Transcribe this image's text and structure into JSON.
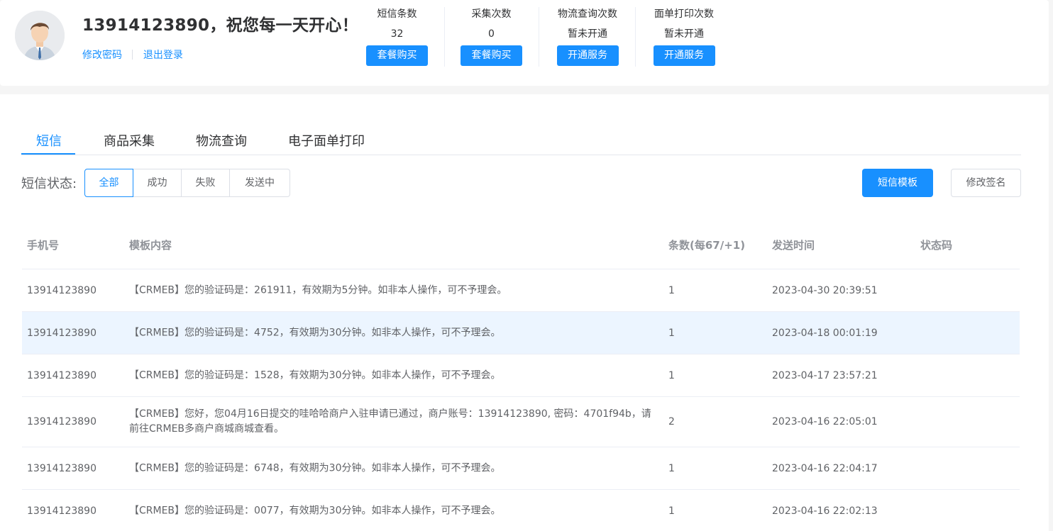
{
  "header": {
    "greeting": "13914123890，祝您每一天开心！",
    "links": {
      "change_password": "修改密码",
      "logout": "退出登录"
    },
    "stats": [
      {
        "label": "短信条数",
        "value": "32",
        "button": "套餐购买"
      },
      {
        "label": "采集次数",
        "value": "0",
        "button": "套餐购买"
      },
      {
        "label": "物流查询次数",
        "value": "暂未开通",
        "button": "开通服务"
      },
      {
        "label": "面单打印次数",
        "value": "暂未开通",
        "button": "开通服务"
      }
    ]
  },
  "tabs": [
    "短信",
    "商品采集",
    "物流查询",
    "电子面单打印"
  ],
  "active_tab": "短信",
  "filter": {
    "label": "短信状态:",
    "options": [
      "全部",
      "成功",
      "失败",
      "发送中"
    ],
    "selected": "全部"
  },
  "actions": {
    "template": "短信模板",
    "signature": "修改签名"
  },
  "table": {
    "columns": [
      "手机号",
      "模板内容",
      "条数(每67/+1)",
      "发送时间",
      "状态码"
    ],
    "rows": [
      {
        "phone": "13914123890",
        "content": "【CRMEB】您的验证码是：261911，有效期为5分钟。如非本人操作，可不予理会。",
        "count": "1",
        "time": "2023-04-30 20:39:51",
        "status": ""
      },
      {
        "phone": "13914123890",
        "content": "【CRMEB】您的验证码是：4752，有效期为30分钟。如非本人操作，可不予理会。",
        "count": "1",
        "time": "2023-04-18 00:01:19",
        "status": ""
      },
      {
        "phone": "13914123890",
        "content": "【CRMEB】您的验证码是：1528，有效期为30分钟。如非本人操作，可不予理会。",
        "count": "1",
        "time": "2023-04-17 23:57:21",
        "status": ""
      },
      {
        "phone": "13914123890",
        "content": "【CRMEB】您好，您04月16日提交的哇哈哈商户入驻申请已通过，商户账号：13914123890, 密码：4701f94b，请前往CRMEB多商户商城商城查看。",
        "count": "2",
        "time": "2023-04-16 22:05:01",
        "status": ""
      },
      {
        "phone": "13914123890",
        "content": "【CRMEB】您的验证码是：6748，有效期为30分钟。如非本人操作，可不予理会。",
        "count": "1",
        "time": "2023-04-16 22:04:17",
        "status": ""
      },
      {
        "phone": "13914123890",
        "content": "【CRMEB】您的验证码是：0077，有效期为30分钟。如非本人操作，可不予理会。",
        "count": "1",
        "time": "2023-04-16 22:02:13",
        "status": ""
      }
    ]
  },
  "colors": {
    "primary": "#1890ff",
    "row_highlight": "#ecf5ff",
    "header_text": "#909399"
  }
}
